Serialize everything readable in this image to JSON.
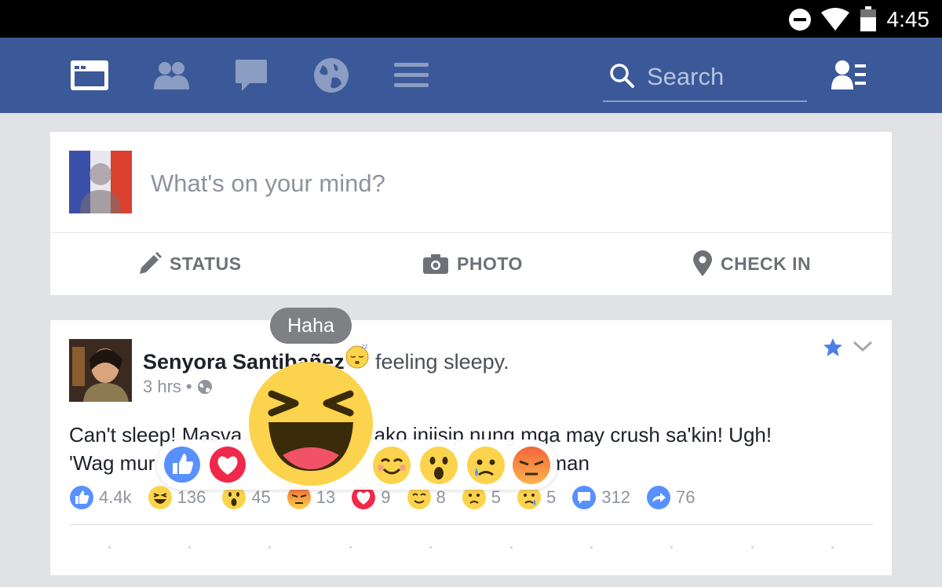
{
  "status_bar": {
    "time": "4:45",
    "icons": [
      "do-not-disturb-icon",
      "wifi-icon",
      "battery-icon"
    ]
  },
  "nav": {
    "icons": [
      "news-feed-icon",
      "friends-icon",
      "messages-icon",
      "notifications-globe-icon",
      "menu-icon",
      "contacts-icon"
    ],
    "search_placeholder": "Search"
  },
  "composer": {
    "prompt": "What's on your mind?",
    "actions": [
      {
        "label": "STATUS",
        "icon": "pencil-icon"
      },
      {
        "label": "PHOTO",
        "icon": "camera-icon"
      },
      {
        "label": "CHECK IN",
        "icon": "location-pin-icon"
      }
    ]
  },
  "post": {
    "author": "Senyora Santibañez",
    "feeling": "feeling sleepy.",
    "time": "3 hrs",
    "body_line1_a": "Can't sleep! Masva",
    "body_line1_b": "vata ako iniisip nung mga may crush sa'kin! Ugh!",
    "body_line2_a": "'Wag mur",
    "body_line2_b": "naman",
    "reactions": [
      {
        "type": "like",
        "count": "4.4k"
      },
      {
        "type": "haha",
        "count": "136"
      },
      {
        "type": "wow",
        "count": "45"
      },
      {
        "type": "angry",
        "count": "13"
      },
      {
        "type": "love",
        "count": "9"
      },
      {
        "type": "yay",
        "count": "8"
      },
      {
        "type": "sad-face",
        "count": "5"
      },
      {
        "type": "sad",
        "count": "5"
      }
    ],
    "comments": "312",
    "shares": "76"
  },
  "reaction_picker": {
    "hovered_label": "Haha",
    "options": [
      "like",
      "love",
      "haha",
      "yay",
      "wow",
      "sad",
      "angry"
    ]
  },
  "colors": {
    "brand": "#3b5998",
    "like_blue": "#5890ff",
    "love_red": "#f0284a",
    "emoji_yellow": "#fcd34c"
  }
}
